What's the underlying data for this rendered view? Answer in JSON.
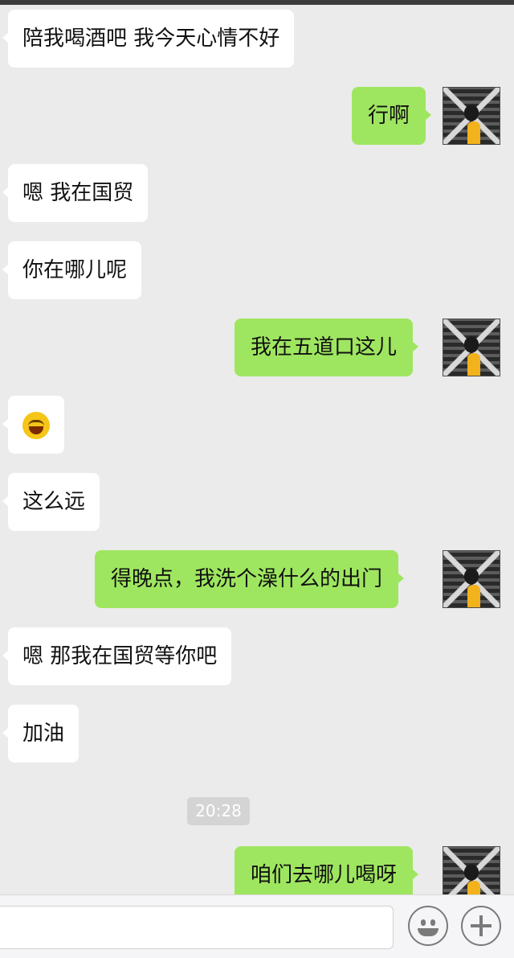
{
  "messages": [
    {
      "side": "left",
      "text": "陪我喝酒吧 我今天心情不好"
    },
    {
      "side": "right",
      "text": "行啊"
    },
    {
      "side": "left",
      "text": "嗯 我在国贸"
    },
    {
      "side": "left",
      "text": "你在哪儿呢"
    },
    {
      "side": "right",
      "text": "我在五道口这儿"
    },
    {
      "side": "left",
      "emoji": "tears-of-joy-emoji"
    },
    {
      "side": "left",
      "text": "这么远"
    },
    {
      "side": "right",
      "text": "得晚点，我洗个澡什么的出门"
    },
    {
      "side": "left",
      "text": "嗯 那我在国贸等你吧"
    },
    {
      "side": "left",
      "text": "加油"
    },
    {
      "side": "right",
      "text": "咱们去哪儿喝呀"
    }
  ],
  "timestamp": "20:28",
  "colors": {
    "background": "#ebebeb",
    "incoming_bubble": "#ffffff",
    "outgoing_bubble": "#9fe660"
  },
  "input_bar": {
    "icons": [
      "smiley-icon",
      "plus-icon"
    ]
  }
}
